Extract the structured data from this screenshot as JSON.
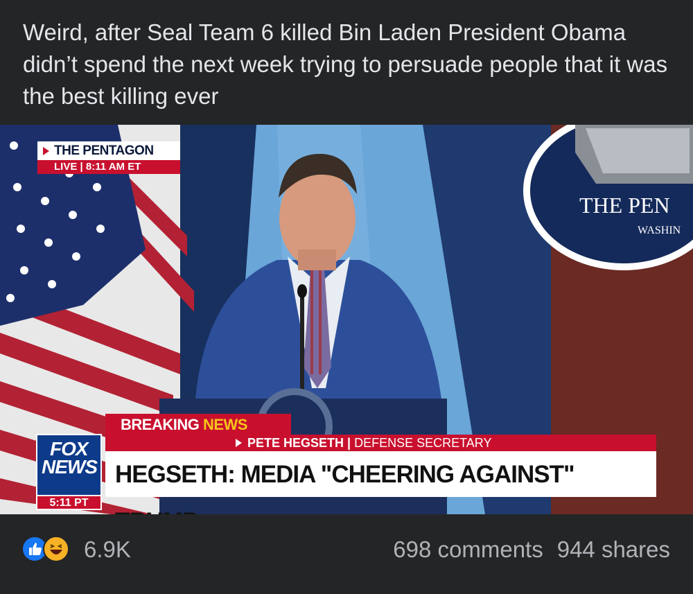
{
  "post": {
    "text": "Weird, after Seal Team 6 killed Bin Laden President Obama didn’t spend the next week trying to persuade people that it was the best killing ever"
  },
  "broadcast": {
    "location": "THE PENTAGON",
    "live_label": "LIVE",
    "live_time": "8:11 AM ET",
    "breaking_word1": "BREAKING",
    "breaking_word2": "NEWS",
    "speaker_name": "PETE HEGSETH",
    "speaker_title": "DEFENSE SECRETARY",
    "headline": "HEGSETH: MEDIA \"CHEERING AGAINST\" TRUMP",
    "network_line1": "FOX",
    "network_line2": "NEWS",
    "network_time": "5:11 PT",
    "backdrop_sign_title": "THE PEN",
    "backdrop_sign_subtitle": "WASHIN"
  },
  "footer": {
    "reactions": [
      "like-icon",
      "haha-icon"
    ],
    "reaction_count": "6.9K",
    "comments": "698 comments",
    "shares": "944 shares"
  },
  "colors": {
    "background": "#242526",
    "text_primary": "#e4e6eb",
    "text_secondary": "#b0b3b8",
    "fox_red": "#c8102e",
    "fox_blue": "#0e3a8a",
    "like_blue": "#1877f2",
    "haha_yellow": "#f7b125"
  }
}
